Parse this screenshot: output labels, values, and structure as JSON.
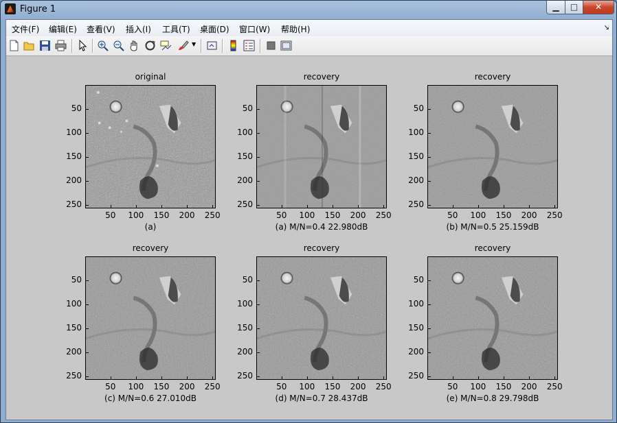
{
  "window": {
    "title": "Figure 1",
    "min": "▁",
    "max": "□",
    "close": "✕"
  },
  "menu": [
    "文件(F)",
    "编辑(E)",
    "查看(V)",
    "插入(I)",
    "工具(T)",
    "桌面(D)",
    "窗口(W)",
    "帮助(H)"
  ],
  "menu_arrow": "↘",
  "toolbar": [
    "new-figure-icon",
    "open-icon",
    "save-icon",
    "print-icon",
    "pointer-icon",
    "zoom-in-icon",
    "zoom-out-icon",
    "pan-icon",
    "rotate-3d-icon",
    "data-cursor-icon",
    "brush-icon",
    "link-plot-icon",
    "colorbar-icon",
    "legend-icon",
    "hide-plot-tools-icon",
    "show-plot-tools-icon"
  ],
  "colors": {
    "client": "#c8c8c8",
    "titlebar": "#8fadd0"
  },
  "panels": [
    {
      "title": "original",
      "caption": "(a)",
      "style": "orig"
    },
    {
      "title": "recovery",
      "caption": "(a)  M/N=0.4  22.980dB",
      "style": "noisy"
    },
    {
      "title": "recovery",
      "caption": "(b)  M/N=0.5  25.159dB",
      "style": "mid"
    },
    {
      "title": "recovery",
      "caption": "(c)  M/N=0.6  27.010dB",
      "style": "good"
    },
    {
      "title": "recovery",
      "caption": "(d)  M/N=0.7  28.437dB",
      "style": "good"
    },
    {
      "title": "recovery",
      "caption": "(e)  M/N=0.8  29.798dB",
      "style": "good"
    }
  ],
  "yticks": [
    "50",
    "100",
    "150",
    "200",
    "250"
  ],
  "xticks": [
    "50",
    "100",
    "150",
    "200",
    "250"
  ]
}
